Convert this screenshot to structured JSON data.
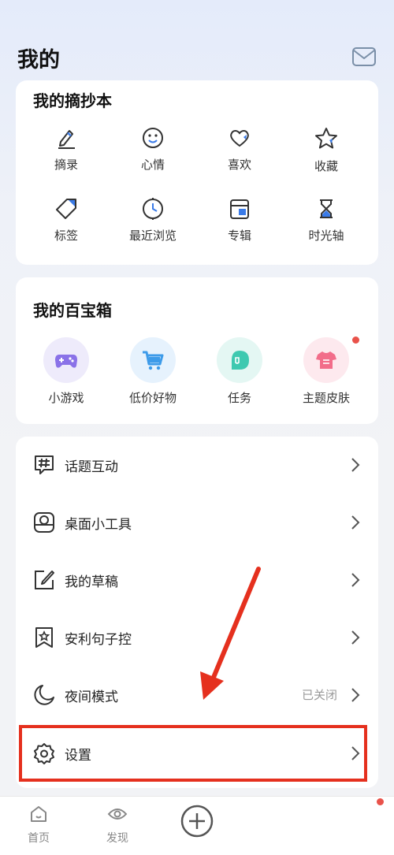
{
  "header": {
    "title": "我的"
  },
  "notebook": {
    "title": "我的摘抄本",
    "items": [
      {
        "label": "摘录",
        "icon": "pencil-icon"
      },
      {
        "label": "心情",
        "icon": "smiley-icon"
      },
      {
        "label": "喜欢",
        "icon": "heart-icon"
      },
      {
        "label": "收藏",
        "icon": "star-icon"
      },
      {
        "label": "标签",
        "icon": "tag-icon"
      },
      {
        "label": "最近浏览",
        "icon": "clock-icon"
      },
      {
        "label": "专辑",
        "icon": "album-icon"
      },
      {
        "label": "时光轴",
        "icon": "hourglass-icon"
      }
    ]
  },
  "toolbox": {
    "title": "我的百宝箱",
    "items": [
      {
        "label": "小游戏",
        "icon": "gamepad-icon",
        "color": "#8a72e8"
      },
      {
        "label": "低价好物",
        "icon": "cart-icon",
        "color": "#3d9be9"
      },
      {
        "label": "任务",
        "icon": "task-icon",
        "color": "#3ec9b0"
      },
      {
        "label": "主题皮肤",
        "icon": "tshirt-icon",
        "color": "#f26d8a"
      }
    ]
  },
  "menu": [
    {
      "label": "话题互动",
      "icon": "hashtag-icon",
      "value": ""
    },
    {
      "label": "桌面小工具",
      "icon": "widget-icon",
      "value": ""
    },
    {
      "label": "我的草稿",
      "icon": "draft-icon",
      "value": ""
    },
    {
      "label": "安利句子控",
      "icon": "bookmark-star-icon",
      "value": ""
    },
    {
      "label": "夜间模式",
      "icon": "moon-icon",
      "value": "已关闭"
    },
    {
      "label": "设置",
      "icon": "gear-icon",
      "value": ""
    }
  ],
  "tabs": [
    {
      "label": "首页",
      "icon": "home-icon"
    },
    {
      "label": "发现",
      "icon": "eye-icon"
    }
  ],
  "colors": {
    "accent": "#3a7be8",
    "highlight": "#e5301e",
    "badge": "#e9524a"
  }
}
